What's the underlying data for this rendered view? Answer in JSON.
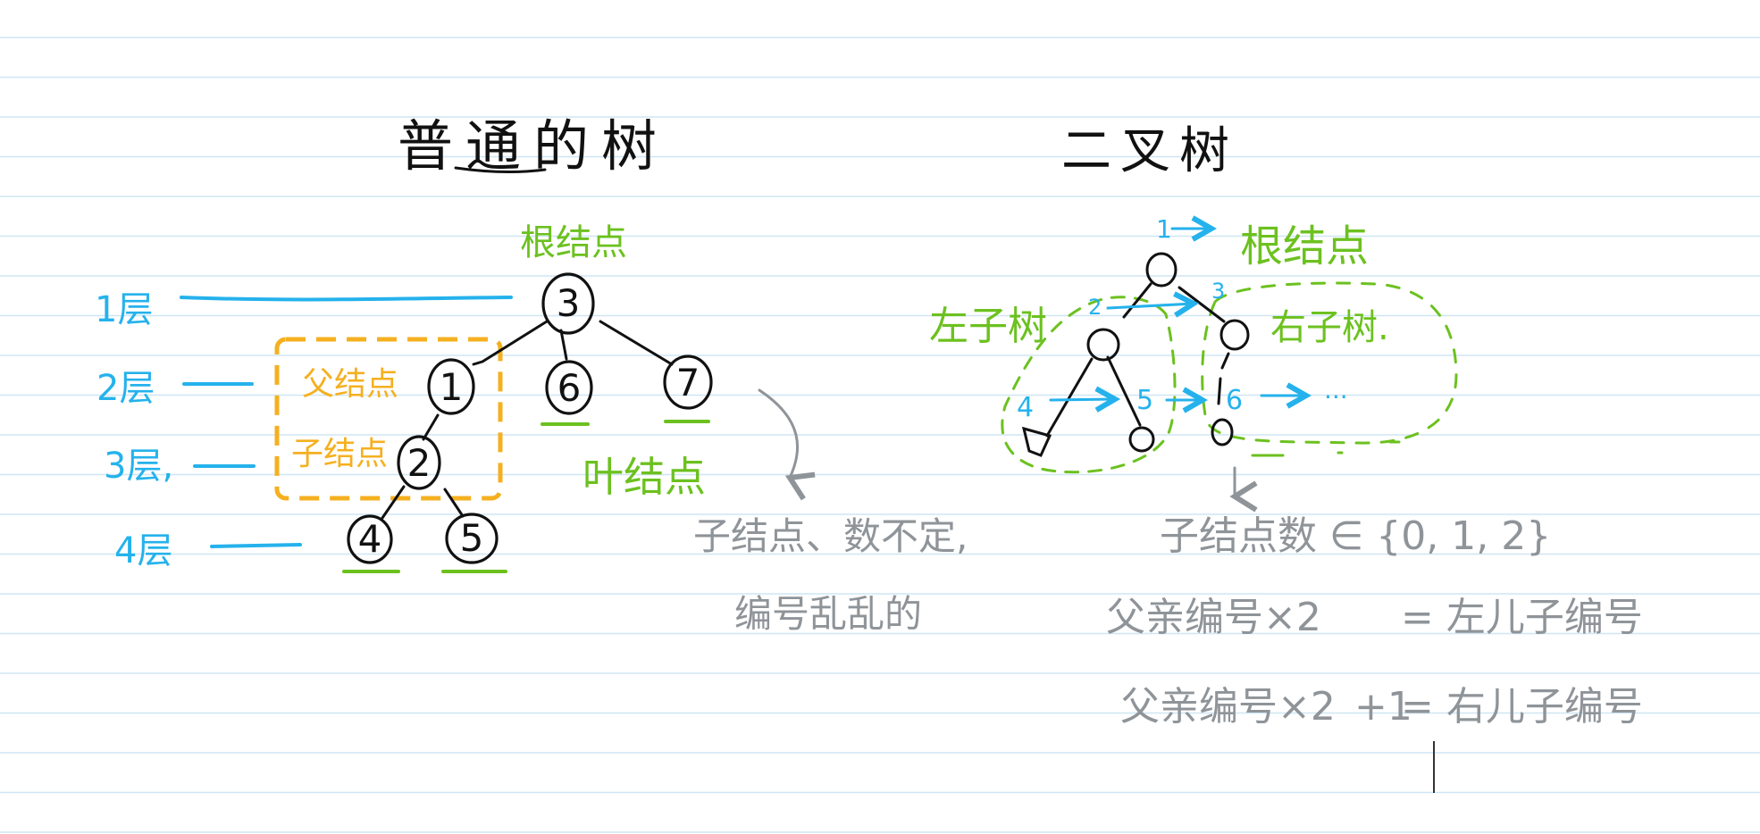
{
  "colors": {
    "ruling": "#cfe6f3",
    "black": "#111111",
    "blue": "#25b2ec",
    "green": "#6cc11f",
    "orange": "#f5b020",
    "gray": "#8f9499"
  },
  "left": {
    "title": "普通的树",
    "root_label": "根结点",
    "levels": [
      "1层",
      "2层",
      "3层,",
      "4层"
    ],
    "parent_label": "父结点",
    "child_label": "子结点",
    "leaf_label": "叶结点",
    "nodes": [
      "3",
      "1",
      "6",
      "7",
      "2",
      "4",
      "5"
    ],
    "note_line1": "子结点、数不定,",
    "note_line2": "编号乱乱的"
  },
  "right": {
    "title": "二叉树",
    "root_label": "根结点",
    "left_subtree": "左子树",
    "right_subtree": "右子树.",
    "numbers": [
      "1",
      "2",
      "3",
      "4",
      "5",
      "6"
    ],
    "ellipsis": "...",
    "note_children": "子结点数 ∈ {0, 1, 2}",
    "formula1_left": "父亲编号×2",
    "formula1_right": "= 左儿子编号",
    "formula2_left": "父亲编号×2",
    "formula2_plus": "+1",
    "formula2_right": "= 右儿子编号"
  }
}
